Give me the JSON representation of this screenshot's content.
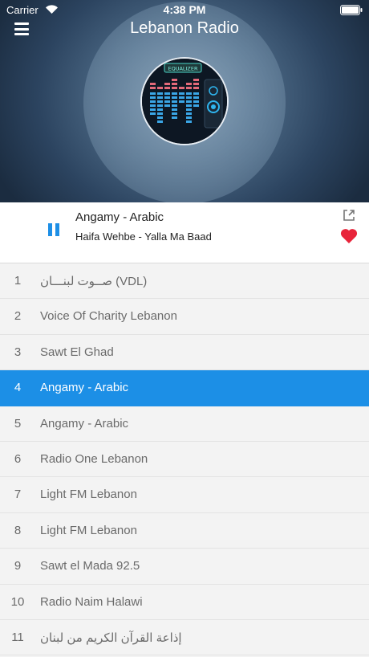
{
  "status_bar": {
    "carrier": "Carrier",
    "time": "4:38 PM"
  },
  "header": {
    "title": "Lebanon Radio",
    "menu_icon": "hamburger-menu-icon",
    "artwork_label": "EQUALIZER"
  },
  "player": {
    "station": "Angamy - Arabic",
    "track": "Haifa Wehbe - Yalla Ma Baad",
    "state": "playing",
    "accent": "#1d8fe6",
    "favorite_color": "#e8243a"
  },
  "stations": [
    {
      "number": "1",
      "name": "صــوت لبنـــان (VDL)"
    },
    {
      "number": "2",
      "name": "Voice Of Charity Lebanon"
    },
    {
      "number": "3",
      "name": "Sawt El Ghad"
    },
    {
      "number": "4",
      "name": "Angamy - Arabic"
    },
    {
      "number": "5",
      "name": "Angamy - Arabic"
    },
    {
      "number": "6",
      "name": "Radio One Lebanon"
    },
    {
      "number": "7",
      "name": "Light FM Lebanon"
    },
    {
      "number": "8",
      "name": "Light FM Lebanon"
    },
    {
      "number": "9",
      "name": "Sawt el Mada 92.5"
    },
    {
      "number": "10",
      "name": "Radio Naim Halawi"
    },
    {
      "number": "11",
      "name": "إذاعة القرآن الكريم من لبنان"
    }
  ],
  "active_station_index": 3
}
